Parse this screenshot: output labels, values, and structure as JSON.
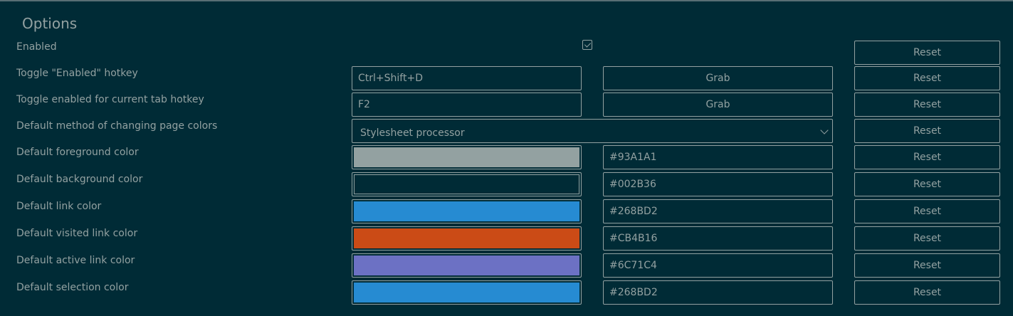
{
  "page": {
    "title": "Options"
  },
  "reset_label": "Reset",
  "grab_label": "Grab",
  "enabled": {
    "label": "Enabled",
    "checked": true
  },
  "hotkeys": {
    "toggle_enabled": {
      "label": "Toggle \"Enabled\" hotkey",
      "value": "Ctrl+Shift+D"
    },
    "toggle_tab": {
      "label": "Toggle enabled for current tab hotkey",
      "value": "F2"
    }
  },
  "method": {
    "label": "Default method of changing page colors",
    "selected": "Stylesheet processor"
  },
  "colors": [
    {
      "label": "Default foreground color",
      "hex": "#93A1A1",
      "swatch": "#93a1a1"
    },
    {
      "label": "Default background color",
      "hex": "#002B36",
      "swatch": "#002b36"
    },
    {
      "label": "Default link color",
      "hex": "#268BD2",
      "swatch": "#268bd2"
    },
    {
      "label": "Default visited link color",
      "hex": "#CB4B16",
      "swatch": "#cb4b16"
    },
    {
      "label": "Default active link color",
      "hex": "#6C71C4",
      "swatch": "#6c71c4"
    },
    {
      "label": "Default selection color",
      "hex": "#268BD2",
      "swatch": "#268bd2"
    }
  ]
}
